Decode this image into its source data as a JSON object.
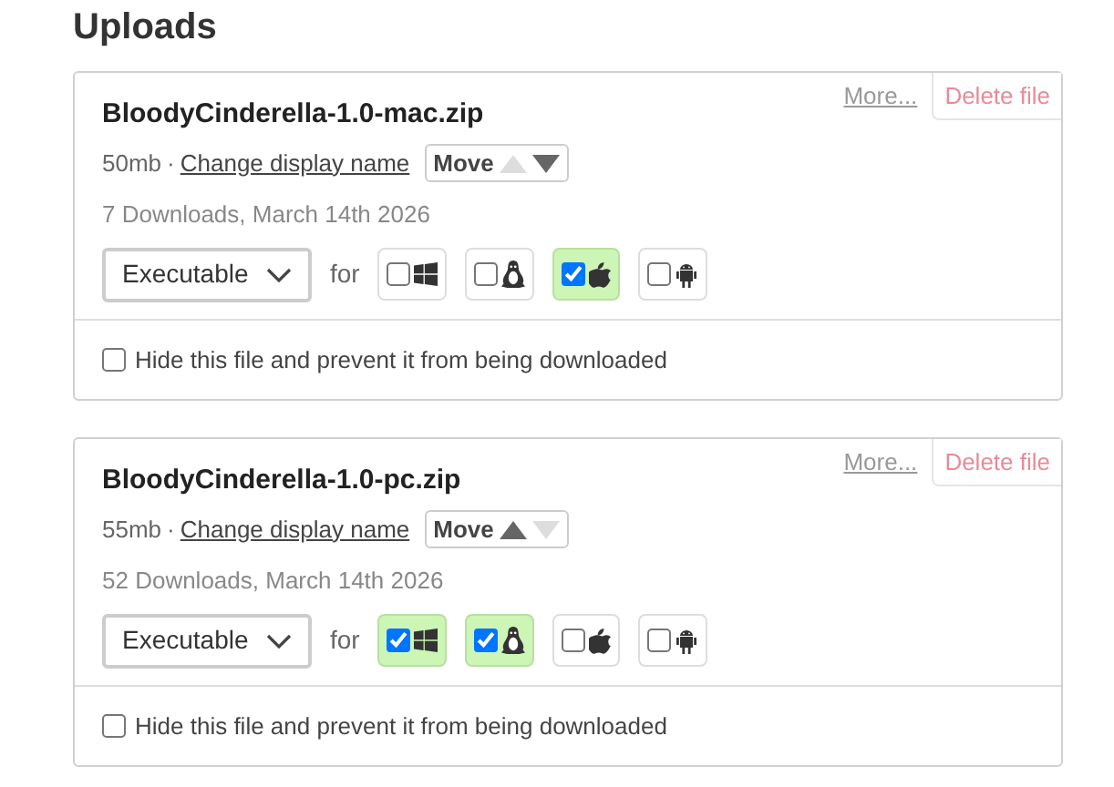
{
  "heading": "Uploads",
  "uploads": [
    {
      "more": "More...",
      "delete": "Delete file",
      "filename": "BloodyCinderella-1.0-mac.zip",
      "size": "50mb",
      "separator": "·",
      "rename": "Change display name",
      "move": {
        "label": "Move",
        "up_enabled": false,
        "down_enabled": true
      },
      "stats": "7 Downloads, March 14th 2026",
      "type": "Executable",
      "for": "for",
      "platforms": [
        {
          "kind": "windows",
          "checked": false
        },
        {
          "kind": "linux",
          "checked": false
        },
        {
          "kind": "mac",
          "checked": true
        },
        {
          "kind": "android",
          "checked": false
        }
      ],
      "hide": {
        "label": "Hide this file and prevent it from being downloaded",
        "checked": false
      }
    },
    {
      "more": "More...",
      "delete": "Delete file",
      "filename": "BloodyCinderella-1.0-pc.zip",
      "size": "55mb",
      "separator": "·",
      "rename": "Change display name",
      "move": {
        "label": "Move",
        "up_enabled": true,
        "down_enabled": false
      },
      "stats": "52 Downloads, March 14th 2026",
      "type": "Executable",
      "for": "for",
      "platforms": [
        {
          "kind": "windows",
          "checked": true
        },
        {
          "kind": "linux",
          "checked": true
        },
        {
          "kind": "mac",
          "checked": false
        },
        {
          "kind": "android",
          "checked": false
        }
      ],
      "hide": {
        "label": "Hide this file and prevent it from being downloaded",
        "checked": false
      }
    }
  ]
}
